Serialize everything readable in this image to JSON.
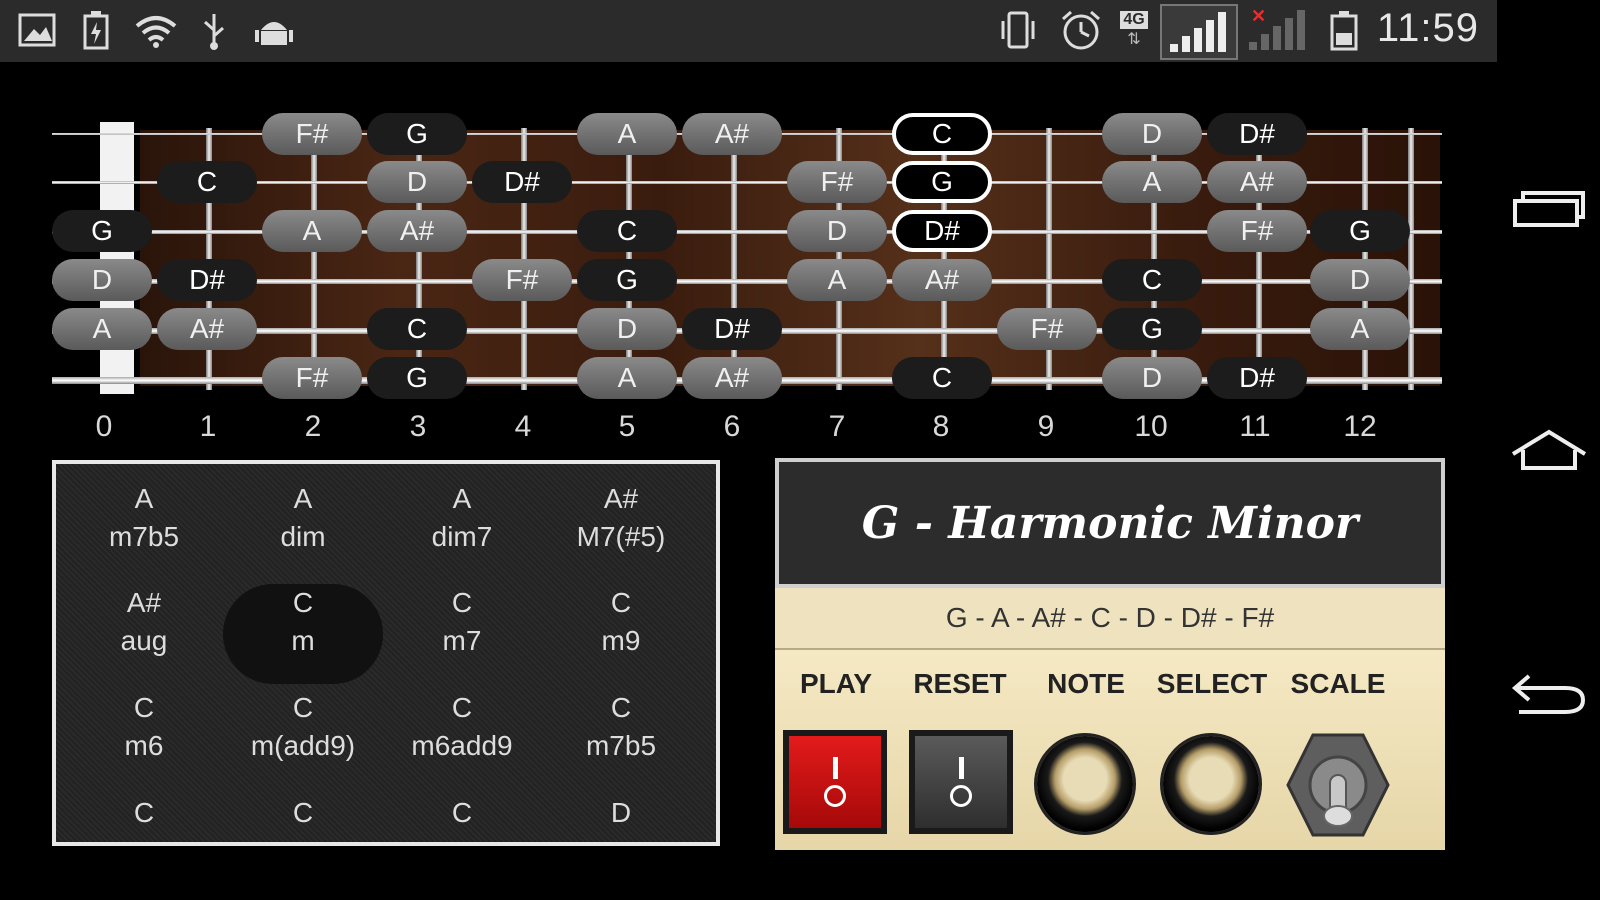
{
  "status_bar": {
    "time": "11:59",
    "left_icons": [
      "image-icon",
      "battery-charging-icon",
      "wifi-icon",
      "usb-icon",
      "android-debug-icon"
    ],
    "right_icons": [
      "vibrate-icon",
      "alarm-icon",
      "4g-data-icon",
      "signal-4g-icon",
      "signal-no-service-icon",
      "battery-icon"
    ],
    "badge_4g": "4G"
  },
  "nav": {
    "items": [
      "recent-apps-icon",
      "home-icon",
      "back-icon"
    ]
  },
  "fretboard": {
    "fret_numbers": [
      "0",
      "1",
      "2",
      "3",
      "4",
      "5",
      "6",
      "7",
      "8",
      "9",
      "10",
      "11",
      "12"
    ],
    "strings": [
      {
        "name": "string-1",
        "notes": [
          "",
          "",
          "F#",
          "G",
          "",
          "A",
          "A#",
          "",
          "C",
          "",
          "D",
          "D#",
          ""
        ]
      },
      {
        "name": "string-2",
        "notes": [
          "",
          "C",
          "",
          "D",
          "D#",
          "",
          "",
          "F#",
          "G",
          "",
          "A",
          "A#",
          ""
        ]
      },
      {
        "name": "string-3",
        "notes": [
          "G",
          "",
          "A",
          "A#",
          "",
          "C",
          "",
          "D",
          "D#",
          "",
          "",
          "F#",
          "G"
        ]
      },
      {
        "name": "string-4",
        "notes": [
          "D",
          "D#",
          "",
          "",
          "F#",
          "G",
          "",
          "A",
          "A#",
          "",
          "C",
          "",
          "D"
        ]
      },
      {
        "name": "string-5",
        "notes": [
          "A",
          "A#",
          "",
          "C",
          "",
          "D",
          "D#",
          "",
          "",
          "F#",
          "G",
          "",
          "A"
        ]
      },
      {
        "name": "string-6",
        "notes": [
          "",
          "",
          "F#",
          "G",
          "",
          "A",
          "A#",
          "",
          "C",
          "",
          "D",
          "D#",
          ""
        ]
      }
    ],
    "highlighted": [
      [
        0,
        8
      ],
      [
        1,
        8
      ],
      [
        2,
        8
      ]
    ]
  },
  "chords": [
    {
      "root": "A",
      "type": "m7b5"
    },
    {
      "root": "A",
      "type": "dim"
    },
    {
      "root": "A",
      "type": "dim7"
    },
    {
      "root": "A#",
      "type": "M7(#5)"
    },
    {
      "root": "A#",
      "type": "aug"
    },
    {
      "root": "C",
      "type": "m",
      "selected": true
    },
    {
      "root": "C",
      "type": "m7"
    },
    {
      "root": "C",
      "type": "m9"
    },
    {
      "root": "C",
      "type": "m6"
    },
    {
      "root": "C",
      "type": "m(add9)"
    },
    {
      "root": "C",
      "type": "m6add9"
    },
    {
      "root": "C",
      "type": "m7b5"
    },
    {
      "root": "C",
      "type": ""
    },
    {
      "root": "C",
      "type": ""
    },
    {
      "root": "C",
      "type": ""
    },
    {
      "root": "D",
      "type": ""
    }
  ],
  "amp": {
    "scale_title": "G - Harmonic Minor",
    "scale_notes": "G - A - A# - C - D - D# - F#",
    "controls": {
      "play": "PLAY",
      "reset": "RESET",
      "note": "NOTE",
      "select": "SELECT",
      "scale": "SCALE"
    },
    "colors": {
      "play_switch": "#d91515",
      "panel": "#efe3bf"
    }
  }
}
